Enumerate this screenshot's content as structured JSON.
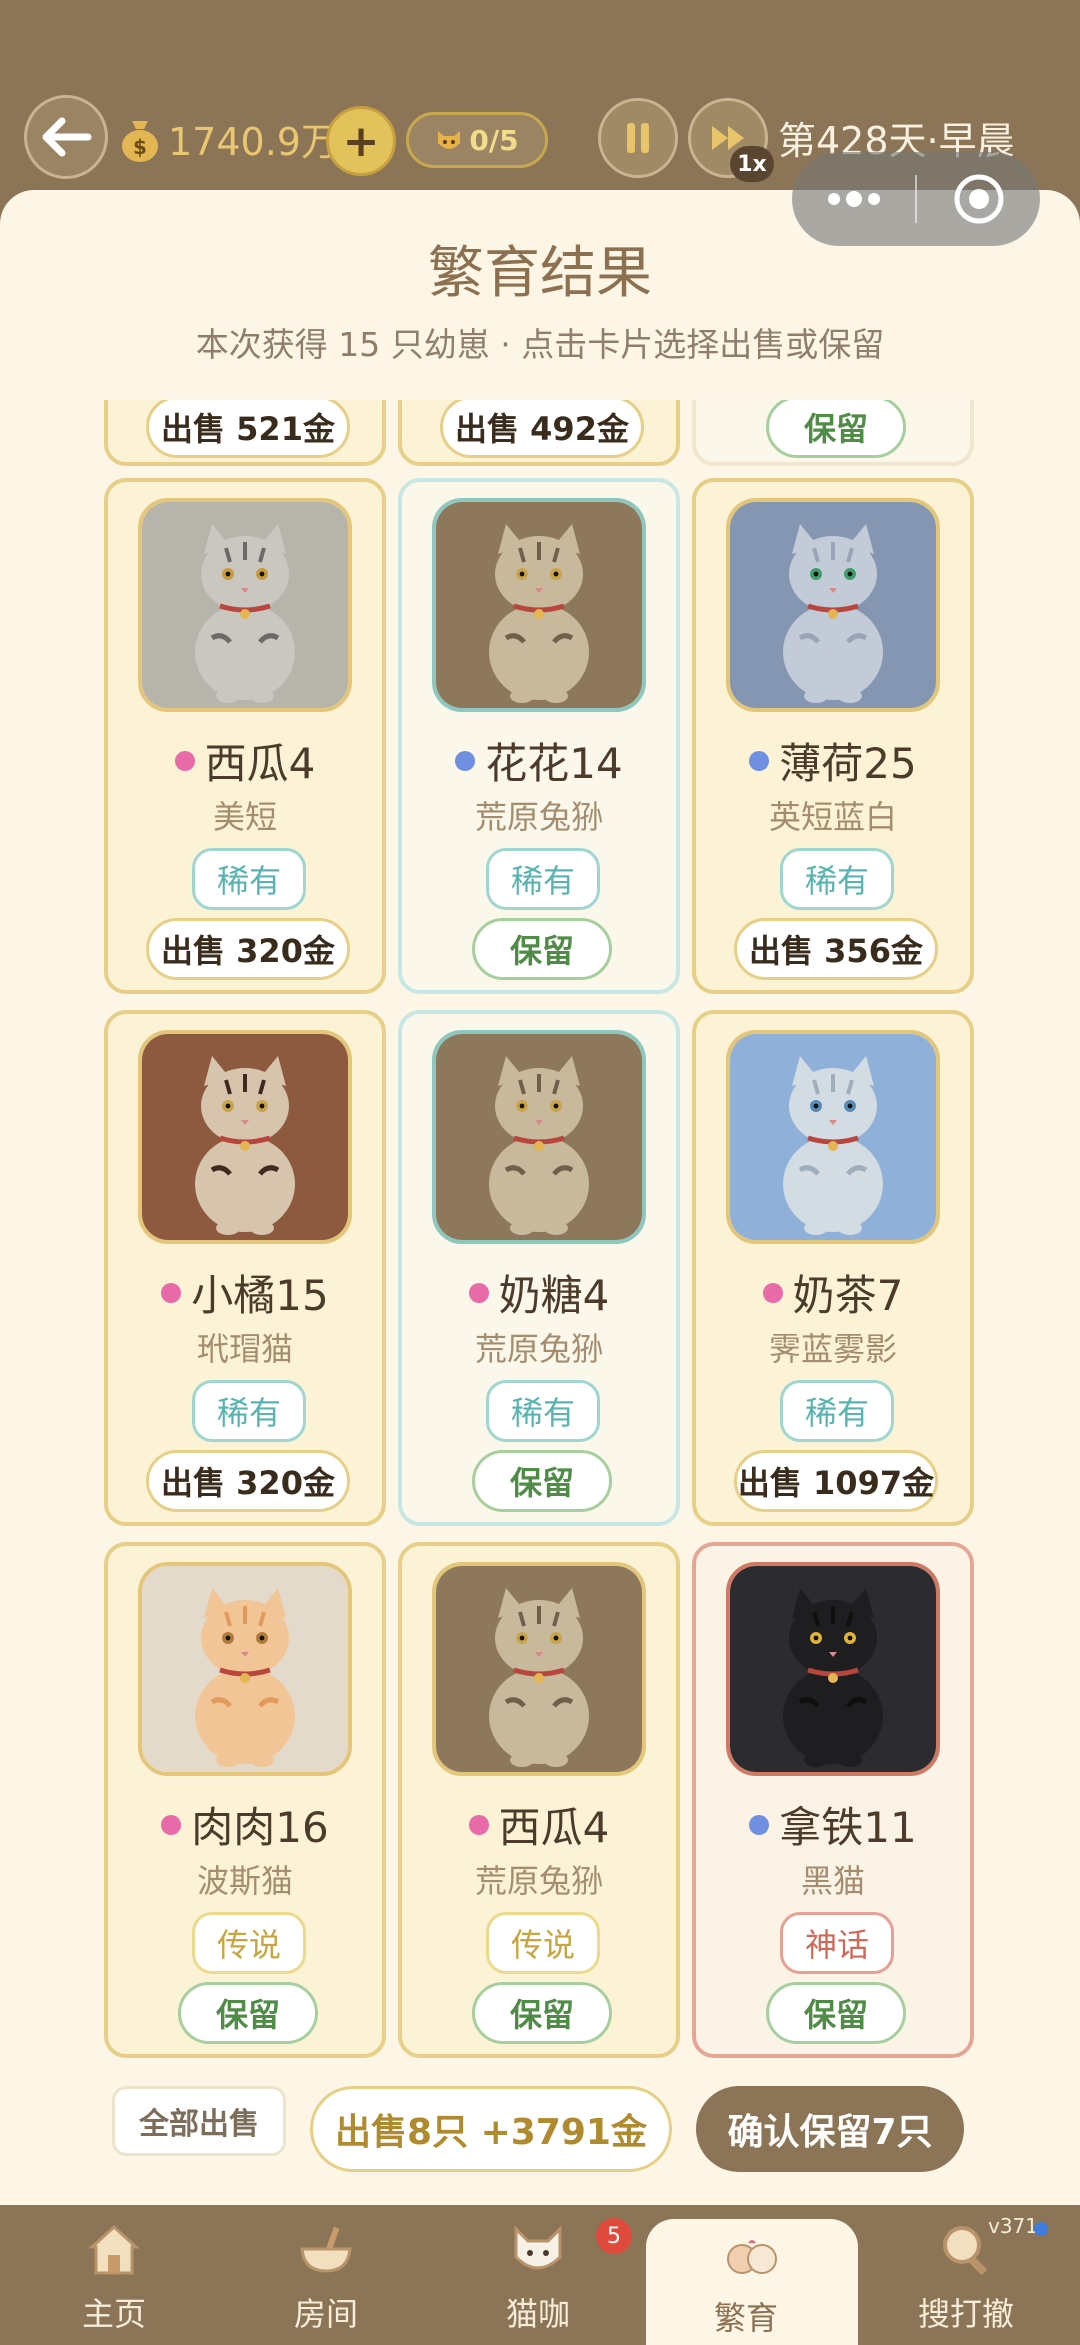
{
  "header": {
    "money": "1740.9万",
    "add_label": "+",
    "cat_count": "0/5",
    "speed": "1x",
    "day": "第428天·早晨"
  },
  "panel": {
    "title": "繁育结果",
    "subtitle": "本次获得 15 只幼崽 · 点击卡片选择出售或保留"
  },
  "partial_row": [
    {
      "action": "sell",
      "action_label": "出售 521金"
    },
    {
      "action": "sell",
      "action_label": "出售 492金"
    },
    {
      "action": "keep",
      "action_label": "保留"
    }
  ],
  "cards": [
    {
      "name": "西瓜4",
      "gender_color": "#e86aa8",
      "breed": "美短",
      "rarity": "稀有",
      "action_label": "出售 320金",
      "portrait_bg": "#b7b5ab",
      "cat_color": "#c9c7c0",
      "stripe": "#6c6a66",
      "eye": "#c99a3b",
      "theme": "gold",
      "action": "sell"
    },
    {
      "name": "花花14",
      "gender_color": "#6f8fe0",
      "breed": "荒原兔狲",
      "rarity": "稀有",
      "action_label": "保留",
      "portrait_bg": "#8d785c",
      "cat_color": "#c8b89c",
      "stripe": "#6f604c",
      "eye": "#c9a44a",
      "theme": "teal",
      "action": "keep"
    },
    {
      "name": "薄荷25",
      "gender_color": "#6f8fe0",
      "breed": "英短蓝白",
      "rarity": "稀有",
      "action_label": "出售 356金",
      "portrait_bg": "#8496b2",
      "cat_color": "#c3cbd9",
      "stripe": "#9aa4b6",
      "eye": "#3f9e6b",
      "theme": "gold",
      "action": "sell"
    },
    {
      "name": "小橘15",
      "gender_color": "#e86aa8",
      "breed": "玳瑁猫",
      "rarity": "稀有",
      "action_label": "出售 320金",
      "portrait_bg": "#8e5a3f",
      "cat_color": "#d7c4ad",
      "stripe": "#3e2a1f",
      "eye": "#c9a44a",
      "theme": "gold",
      "action": "sell"
    },
    {
      "name": "奶糖4",
      "gender_color": "#e86aa8",
      "breed": "荒原兔狲",
      "rarity": "稀有",
      "action_label": "保留",
      "portrait_bg": "#8d785c",
      "cat_color": "#c8b89c",
      "stripe": "#6f604c",
      "eye": "#c9a44a",
      "theme": "teal",
      "action": "keep"
    },
    {
      "name": "奶茶7",
      "gender_color": "#e86aa8",
      "breed": "霁蓝雾影",
      "rarity": "稀有",
      "action_label": "出售 1097金",
      "portrait_bg": "#8fb0d8",
      "cat_color": "#d3dbe3",
      "stripe": "#a0adba",
      "eye": "#5a8ab8",
      "theme": "gold",
      "action": "sell"
    },
    {
      "name": "肉肉16",
      "gender_color": "#e86aa8",
      "breed": "波斯猫",
      "rarity": "传说",
      "action_label": "保留",
      "portrait_bg": "#e4dacb",
      "cat_color": "#f2c596",
      "stripe": "#e19a5c",
      "eye": "#b07a3a",
      "theme": "gold",
      "action": "keep",
      "rarity_style": "legend"
    },
    {
      "name": "西瓜4",
      "gender_color": "#e86aa8",
      "breed": "荒原兔狲",
      "rarity": "传说",
      "action_label": "保留",
      "portrait_bg": "#8d785c",
      "cat_color": "#c8b89c",
      "stripe": "#6f604c",
      "eye": "#c9a44a",
      "theme": "gold",
      "action": "keep",
      "rarity_style": "legend"
    },
    {
      "name": "拿铁11",
      "gender_color": "#6f8fe0",
      "breed": "黑猫",
      "rarity": "神话",
      "action_label": "保留",
      "portrait_bg": "#2c2c30",
      "cat_color": "#1e1d20",
      "stripe": "#0f0f10",
      "eye": "#e0b23a",
      "theme": "red",
      "action": "keep",
      "rarity_style": "myth"
    }
  ],
  "footer": {
    "sell_all": "全部出售",
    "sell_summary": "出售8只 +3791金",
    "confirm": "确认保留7只"
  },
  "tabs": [
    {
      "label": "主页",
      "icon": "house-icon"
    },
    {
      "label": "房间",
      "icon": "bowl-icon"
    },
    {
      "label": "猫咖",
      "icon": "cat-face-icon"
    },
    {
      "label": "繁育",
      "icon": "cat-couple-icon"
    },
    {
      "label": "搜打撤",
      "icon": "magnifier-icon"
    }
  ],
  "cafe_badge": "5",
  "version": "v371"
}
